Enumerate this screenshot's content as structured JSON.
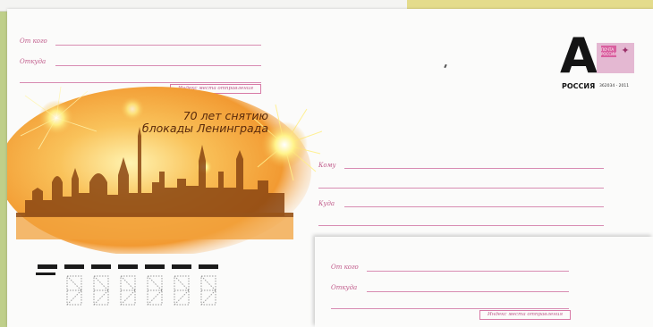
{
  "envelope_main": {
    "from_label": "От кого",
    "from_where_label": "Откуда",
    "index_box_label": "Индекс места отправления",
    "to_label": "Кому",
    "to_where_label": "Куда"
  },
  "artwork": {
    "title_line1": "70 лет снятию",
    "title_line2": "блокады Ленинграда",
    "palette": {
      "sky": "#f6b24a",
      "glow": "#fff2a0",
      "silhouette": "#7a3a0e"
    }
  },
  "stamp": {
    "letter": "А",
    "country": "РОССИЯ",
    "brand": "ПОЧТА РОССИИ",
    "code": "362034 - 2011",
    "accent_color": "#d95f9f"
  },
  "envelope_second": {
    "from_label": "От кого",
    "from_where_label": "Откуда",
    "index_box_label": "Индекс места отправления"
  },
  "postal_code": {
    "digit_count": 6
  },
  "colors": {
    "line": "#d88cb2",
    "label": "#c05a8a"
  }
}
